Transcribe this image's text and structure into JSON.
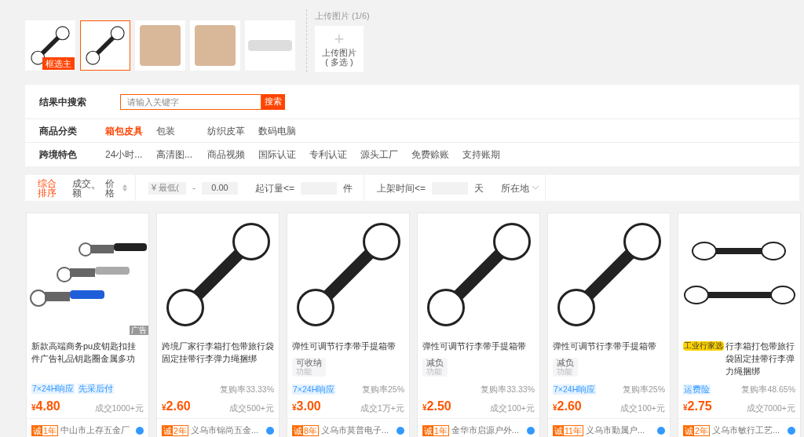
{
  "thumbnails": [
    {
      "kind": "strap",
      "selected": false,
      "label": "框选主"
    },
    {
      "kind": "strap",
      "selected": true
    },
    {
      "kind": "bag",
      "selected": false
    },
    {
      "kind": "bag",
      "selected": false
    },
    {
      "kind": "case",
      "selected": false
    }
  ],
  "upload": {
    "title": "上传图片 (1/6)",
    "plus": "+",
    "button": "上传图片",
    "sub": "( 多选 )"
  },
  "search": {
    "label": "结果中搜索",
    "placeholder": "请输入关键字",
    "button": "搜索"
  },
  "filters": [
    {
      "label": "商品分类",
      "options": [
        {
          "text": "箱包皮具",
          "selected": true
        },
        {
          "text": "包装",
          "selected": false
        },
        {
          "text": "纺织皮革",
          "selected": false
        },
        {
          "text": "数码电脑",
          "selected": false
        }
      ]
    },
    {
      "label": "跨境特色",
      "options": [
        {
          "text": "24小时...",
          "selected": false
        },
        {
          "text": "高清图...",
          "selected": false
        },
        {
          "text": "商品视频",
          "selected": false
        },
        {
          "text": "国际认证",
          "selected": false
        },
        {
          "text": "专利认证",
          "selected": false
        },
        {
          "text": "源头工厂",
          "selected": false
        },
        {
          "text": "免费赊账",
          "selected": false
        },
        {
          "text": "支持账期",
          "selected": false
        }
      ]
    }
  ],
  "sort": [
    {
      "text": "综合排序",
      "selected": true,
      "kind": "plain"
    },
    {
      "text": "成交额",
      "selected": false,
      "kind": "down"
    },
    {
      "text": "价格",
      "selected": false,
      "kind": "updown"
    }
  ],
  "price_filter": {
    "placeholder": "¥ 最低(",
    "dash": "-",
    "value": "0.00"
  },
  "moq": {
    "label": "起订量<=",
    "unit": "件"
  },
  "listing": {
    "label": "上架时间<=",
    "unit": "天"
  },
  "location": {
    "label": "所在地"
  },
  "currency": "¥",
  "products": [
    {
      "kind": "keychain",
      "ad": "广告",
      "title": "新款高端商务pu皮钥匙扣挂件广告礼品钥匙圈金属多功",
      "tags": [
        "7×24H响应",
        "先采后付"
      ],
      "price": "4.80",
      "volume": "成交1000+元",
      "seller_badge": "诚",
      "years": "1年",
      "seller": "中山市上存五金厂"
    },
    {
      "kind": "strap",
      "title": "跨境厂家行李箱打包带旅行袋固定挂带行李弹力绳捆绑",
      "repurchase": "复购率33.33%",
      "price": "2.60",
      "volume": "成交500+元",
      "seller_badge": "诚",
      "years": "2年",
      "seller": "义乌市锦尚五金..."
    },
    {
      "kind": "strap",
      "title": "弹性可调节行李带手提箱带",
      "spec": [
        "可收纳",
        "功能"
      ],
      "tags": [
        "7×24H响应"
      ],
      "repurchase": "复购率25%",
      "price": "3.00",
      "volume": "成交1万+元",
      "seller_badge": "诚",
      "years": "8年",
      "seller": "义乌市莫普电子..."
    },
    {
      "kind": "strap",
      "title": "弹性可调节行李带手提箱带",
      "spec": [
        "减负",
        "功能"
      ],
      "repurchase": "复购率33.33%",
      "price": "2.50",
      "volume": "成交100+元",
      "seller_badge": "诚",
      "years": "1年",
      "seller": "金华市启源户外..."
    },
    {
      "kind": "strap",
      "title": "弹性可调节行李带手提箱带",
      "spec": [
        "减负",
        "功能"
      ],
      "tags": [
        "7×24H响应"
      ],
      "repurchase": "复购率25%",
      "price": "2.60",
      "volume": "成交100+元",
      "seller_badge": "诚",
      "years": "11年",
      "seller": "义乌市勤属户..."
    },
    {
      "kind": "double",
      "badge": "工业行家选",
      "title": "行李箱打包带旅行袋固定挂带行李弹力绳捆绑",
      "tags": [
        "运费险"
      ],
      "repurchase": "复购率48.65%",
      "price": "2.75",
      "volume": "成交7000+元",
      "seller_badge": "诚",
      "years": "2年",
      "seller": "义乌市敏行工艺..."
    }
  ]
}
